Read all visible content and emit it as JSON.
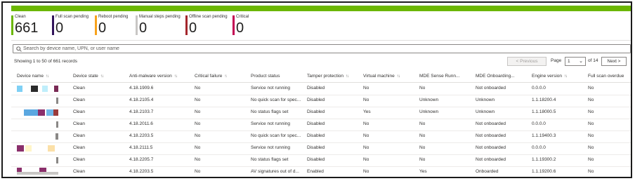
{
  "colors": {
    "top_bar": "#6bb700",
    "clean": "#6bb700",
    "full_scan_pending": "#32145a",
    "reboot_pending": "#f7a21b",
    "manual_steps_pending": "#c8c6c4",
    "offline_scan_pending": "#a4262c",
    "critical": "#c30052"
  },
  "tiles": [
    {
      "label": "Clean",
      "value": "661"
    },
    {
      "label": "Full scan pending",
      "value": "0"
    },
    {
      "label": "Reboot pending",
      "value": "0"
    },
    {
      "label": "Manual steps pending",
      "value": "0"
    },
    {
      "label": "Offline scan pending",
      "value": "0"
    },
    {
      "label": "Critical",
      "value": "0"
    }
  ],
  "search": {
    "placeholder": "Search by device name, UPN, or user name",
    "icon": "search-icon"
  },
  "records_text": "Showing 1 to 50 of 661 records",
  "pager": {
    "previous": "< Previous",
    "page_label": "Page",
    "page_value": "1",
    "of_label": "of 14",
    "next": "Next >"
  },
  "columns": [
    "Device name",
    "Device state",
    "Anti-malware version",
    "Critical failure",
    "Product status",
    "Tamper protection",
    "Virtual machine",
    "MDE Sense Runn...",
    "MDE Onboarding...",
    "Engine version",
    "Full scan overdue"
  ],
  "rows": [
    {
      "device": "",
      "state": "Clean",
      "am": "4.18.1909.6",
      "crit": "No",
      "status": "Service not running",
      "tamper": "Disabled",
      "vm": "No",
      "sense": "No",
      "onboard": "Not onboarded",
      "engine": "0.0.0.0",
      "overdue": "No"
    },
    {
      "device": "",
      "state": "Clean",
      "am": "4.18.2105.4",
      "crit": "No",
      "status": "No quick scan for spec...",
      "tamper": "Disabled",
      "vm": "No",
      "sense": "Unknown",
      "onboard": "Unknown",
      "engine": "1.1.18200.4",
      "overdue": "No"
    },
    {
      "device": "",
      "state": "Clean",
      "am": "4.18.2103.7",
      "crit": "No",
      "status": "No status flags set",
      "tamper": "Disabled",
      "vm": "Yes",
      "sense": "Unknown",
      "onboard": "Unknown",
      "engine": "1.1.18000.5",
      "overdue": "No"
    },
    {
      "device": "",
      "state": "Clean",
      "am": "4.18.2011.6",
      "crit": "No",
      "status": "Service not running",
      "tamper": "Disabled",
      "vm": "No",
      "sense": "No",
      "onboard": "Not onboarded",
      "engine": "0.0.0.0",
      "overdue": "No"
    },
    {
      "device": "",
      "state": "Clean",
      "am": "4.18.2203.5",
      "crit": "No",
      "status": "No quick scan for spec...",
      "tamper": "Disabled",
      "vm": "No",
      "sense": "No",
      "onboard": "Not onboarded",
      "engine": "1.1.19400.3",
      "overdue": "No"
    },
    {
      "device": "",
      "state": "Clean",
      "am": "4.18.2111.5",
      "crit": "No",
      "status": "Service not running",
      "tamper": "Disabled",
      "vm": "No",
      "sense": "No",
      "onboard": "Not onboarded",
      "engine": "0.0.0.0",
      "overdue": "No"
    },
    {
      "device": "",
      "state": "Clean",
      "am": "4.18.2205.7",
      "crit": "No",
      "status": "No status flags set",
      "tamper": "Disabled",
      "vm": "No",
      "sense": "No",
      "onboard": "Not onboarded",
      "engine": "1.1.19300.2",
      "overdue": "No"
    },
    {
      "device": "",
      "state": "Clean",
      "am": "4.18.2203.5",
      "crit": "No",
      "status": "AV signatures out of d...",
      "tamper": "Enabled",
      "vm": "No",
      "sense": "Yes",
      "onboard": "Onboarded",
      "engine": "1.1.19200.6",
      "overdue": "No"
    }
  ]
}
